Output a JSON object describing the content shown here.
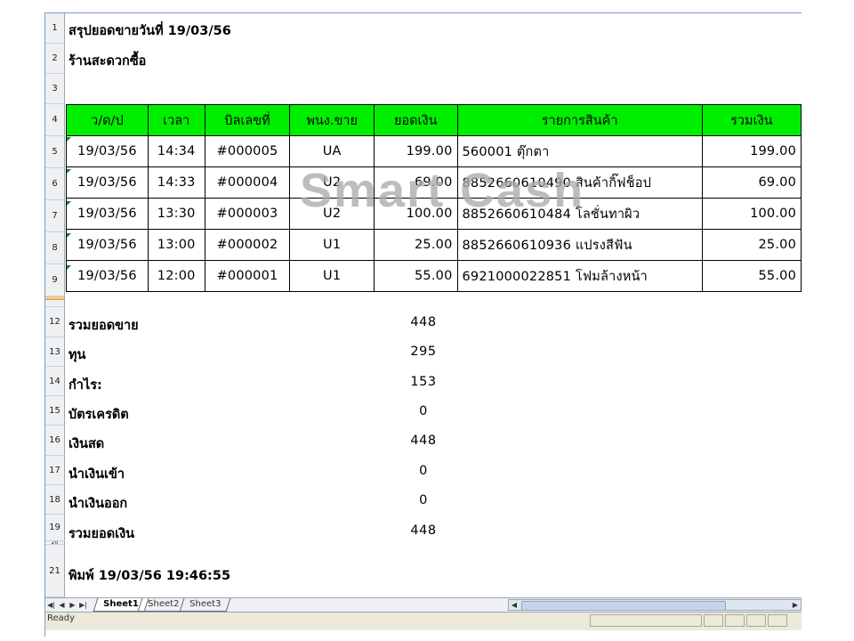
{
  "sheet": {
    "title_line": "สรุปยอดขายวันที่ 19/03/56",
    "shop_name": "ร้านสะดวกซื้อ",
    "watermark": "Smart Cash",
    "row_numbers": {
      "r1": "1",
      "r2": "2",
      "r3": "3",
      "r4": "4",
      "r5": "5",
      "r6": "6",
      "r7": "7",
      "r8": "8",
      "r9": "9",
      "r12": "12",
      "r13": "13",
      "r14": "14",
      "r15": "15",
      "r16": "16",
      "r17": "17",
      "r18": "18",
      "r19": "19",
      "r20": "20",
      "r21": "21"
    }
  },
  "table": {
    "headers": {
      "date": "ว/ด/ป",
      "time": "เวลา",
      "bill": "บิลเลขที่",
      "staff": "พนง.ขาย",
      "amount": "ยอดเงิน",
      "items": "รายการสินค้า",
      "total": "รวมเงิน"
    },
    "rows": [
      {
        "date": "19/03/56",
        "time": "14:34",
        "bill": "#000005",
        "staff": "UA",
        "amount": "199.00",
        "items": "560001 ตุ๊กตา",
        "total": "199.00"
      },
      {
        "date": "19/03/56",
        "time": "14:33",
        "bill": "#000004",
        "staff": "U2",
        "amount": "69.00",
        "items": "8852660610490 สินค้ากิ๊ฟช็อป",
        "total": "69.00"
      },
      {
        "date": "19/03/56",
        "time": "13:30",
        "bill": "#000003",
        "staff": "U2",
        "amount": "100.00",
        "items": "8852660610484 โลชั่นทาผิว",
        "total": "100.00"
      },
      {
        "date": "19/03/56",
        "time": "13:00",
        "bill": "#000002",
        "staff": "U1",
        "amount": "25.00",
        "items": "8852660610936 แปรงสีฟัน",
        "total": "25.00"
      },
      {
        "date": "19/03/56",
        "time": "12:00",
        "bill": "#000001",
        "staff": "U1",
        "amount": "55.00",
        "items": "6921000022851 โฟมล้างหน้า",
        "total": "55.00"
      }
    ]
  },
  "summary": {
    "total_sales_label": "รวมยอดขาย",
    "total_sales": "448",
    "cost_label": "ทุน",
    "cost": "295",
    "profit_label": "กำไร:",
    "profit": "153",
    "credit_card_label": "บัตรเครดิต",
    "credit_card": "0",
    "cash_label": "เงินสด",
    "cash": "448",
    "cash_in_label": "นำเงินเข้า",
    "cash_in": "0",
    "cash_out_label": "นำเงินออก",
    "cash_out": "0",
    "total_money_label": "รวมยอดเงิน",
    "total_money": "448",
    "printed": "พิมพ์ 19/03/56 19:46:55"
  },
  "tabs": [
    "Sheet1",
    "Sheet2",
    "Sheet3"
  ],
  "status": {
    "text": "Ready"
  },
  "colors": {
    "header_green": "#00ee00",
    "selection_orange": "#f9c984"
  }
}
